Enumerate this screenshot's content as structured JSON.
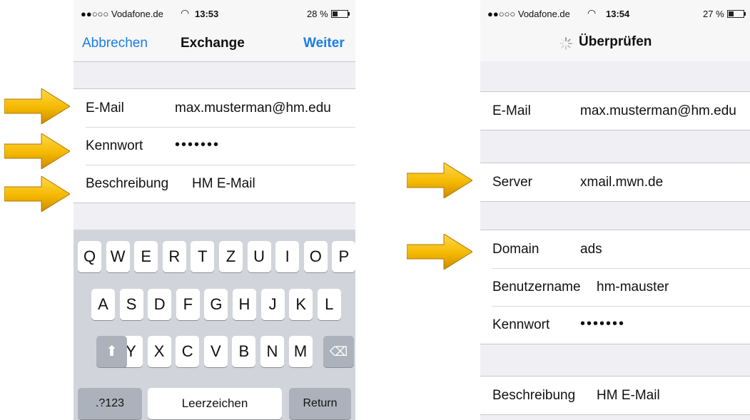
{
  "left": {
    "status": {
      "carrier": "●●○○○ Vodafone.de",
      "time": "13:53",
      "battery": "28 %"
    },
    "nav": {
      "cancel": "Abbrechen",
      "title": "Exchange",
      "next": "Weiter"
    },
    "fields": [
      {
        "label": "E-Mail",
        "value": "max.musterman@hm.edu"
      },
      {
        "label": "Kennwort",
        "value": "•••••••"
      },
      {
        "label": "Beschreibung",
        "value": "HM E-Mail"
      }
    ],
    "keyboard": {
      "row1": [
        "Q",
        "W",
        "E",
        "R",
        "T",
        "Z",
        "U",
        "I",
        "O",
        "P"
      ],
      "row2": [
        "A",
        "S",
        "D",
        "F",
        "G",
        "H",
        "J",
        "K",
        "L"
      ],
      "row3": [
        "Y",
        "X",
        "C",
        "V",
        "B",
        "N",
        "M"
      ],
      "numbers": ".?123",
      "space": "Leerzeichen",
      "return": "Return"
    }
  },
  "right": {
    "status": {
      "carrier": "●●○○○ Vodafone.de",
      "time": "13:54",
      "battery": "27 %"
    },
    "nav": {
      "title": "Überprüfen"
    },
    "email": {
      "label": "E-Mail",
      "value": "max.musterman@hm.edu"
    },
    "server": {
      "label": "Server",
      "value": "xmail.mwn.de"
    },
    "domain": {
      "label": "Domain",
      "value": "ads"
    },
    "username": {
      "label": "Benutzername",
      "value": "hm-mauster"
    },
    "password": {
      "label": "Kennwort",
      "value": "•••••••"
    },
    "description": {
      "label": "Beschreibung",
      "value": "HM E-Mail"
    }
  },
  "colors": {
    "accent": "#1a7ee6",
    "arrow": "#f5b800"
  }
}
